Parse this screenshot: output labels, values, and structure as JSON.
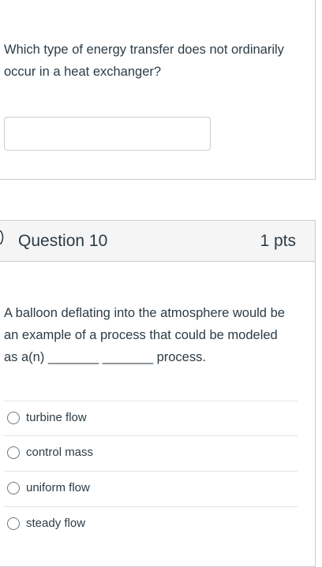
{
  "prev_question": {
    "text": "Which type of energy transfer does not ordinarily occur in a heat exchanger?",
    "answer_value": ""
  },
  "question": {
    "title": "Question 10",
    "points": "1 pts",
    "text": "A balloon deflating into the atmosphere would be an example of a process that could be modeled as a(n) _______ _______ process.",
    "options": [
      {
        "label": "turbine flow",
        "selected": false
      },
      {
        "label": "control mass",
        "selected": false
      },
      {
        "label": "uniform flow",
        "selected": false
      },
      {
        "label": "steady flow",
        "selected": false
      }
    ]
  }
}
